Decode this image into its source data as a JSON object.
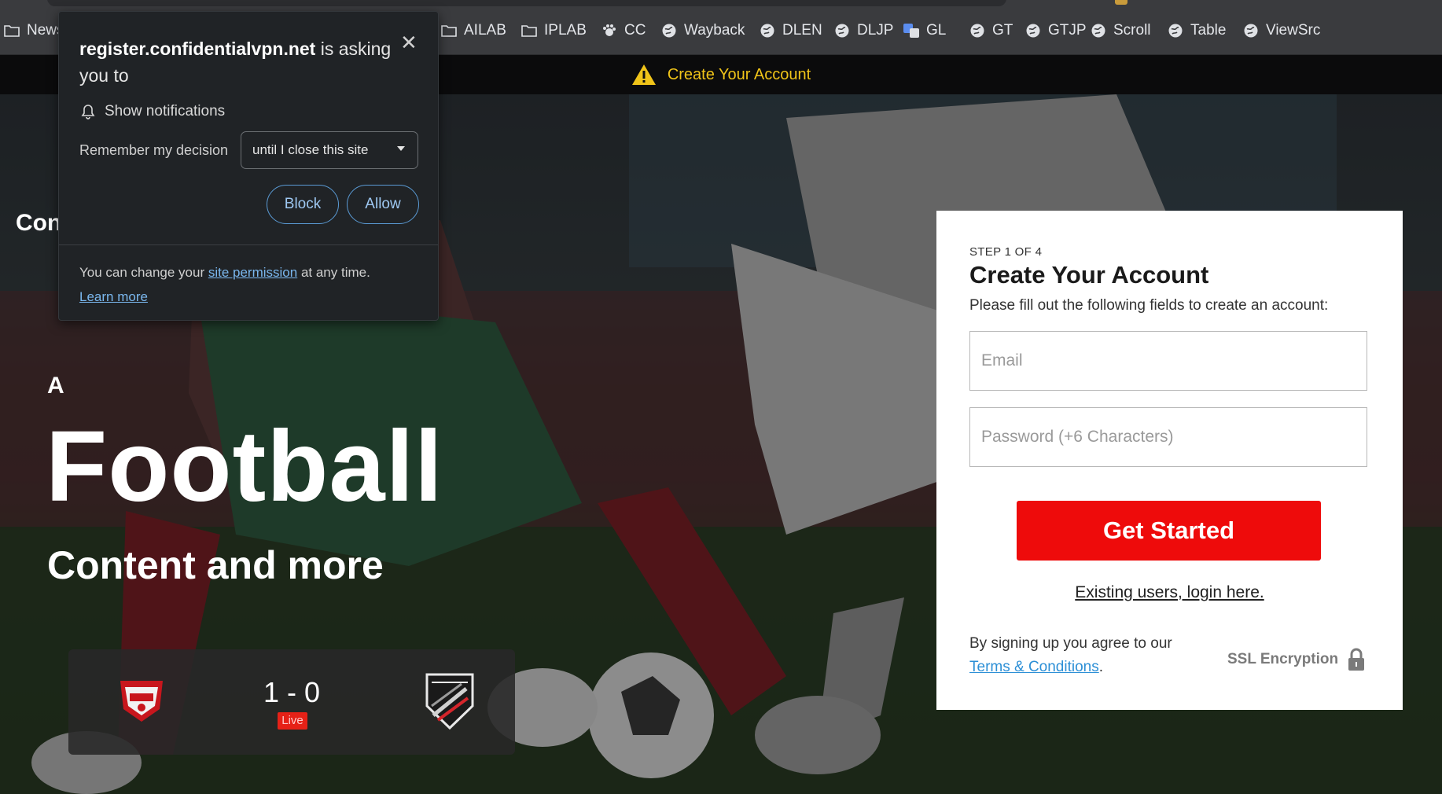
{
  "bookmarks": [
    {
      "label": "News",
      "icon": "folder-icon"
    },
    {
      "label": "AILAB",
      "icon": "folder-icon"
    },
    {
      "label": "IPLAB",
      "icon": "folder-icon"
    },
    {
      "label": "CC",
      "icon": "paw-icon"
    },
    {
      "label": "Wayback",
      "icon": "globe-icon"
    },
    {
      "label": "DLEN",
      "icon": "globe-icon"
    },
    {
      "label": "DLJP",
      "icon": "globe-icon"
    },
    {
      "label": "GL",
      "icon": "translate-icon"
    },
    {
      "label": "GT",
      "icon": "globe-icon"
    },
    {
      "label": "GTJP",
      "icon": "globe-icon"
    },
    {
      "label": "Scroll",
      "icon": "globe-icon"
    },
    {
      "label": "Table",
      "icon": "globe-icon"
    },
    {
      "label": "ViewSrc",
      "icon": "globe-icon"
    }
  ],
  "topbar": {
    "text": "Create Your Account",
    "icon": "warning-icon",
    "color": "#f0c419"
  },
  "hero": {
    "brand": "Con",
    "letter": "A",
    "title": "Football",
    "subtitle": "Content and more",
    "score": {
      "result": "1 - 0",
      "status": "Live",
      "home_logo": "home-team-crest-icon",
      "away_logo": "away-team-crest-icon"
    }
  },
  "signup": {
    "step": "STEP 1 OF 4",
    "title": "Create Your Account",
    "description": "Please fill out the following fields to create an account:",
    "email_placeholder": "Email",
    "password_placeholder": "Password (+6 Characters)",
    "submit_label": "Get Started",
    "login_link": "Existing users, login here.",
    "agree_prefix": "By signing up you agree to our",
    "terms_link": "Terms & Conditions",
    "agree_suffix": ".",
    "ssl_label": "SSL Encryption",
    "accent_color": "#ee0b0b"
  },
  "permission_popup": {
    "site": "register.confidentialvpn.net",
    "asking": "is asking you to",
    "permission": "Show notifications",
    "remember_label": "Remember my decision",
    "remember_value": "until I close this site",
    "block_label": "Block",
    "allow_label": "Allow",
    "footer_prefix": "You can change your",
    "footer_link": "site permission",
    "footer_suffix": "at any time.",
    "learn_more": "Learn more"
  }
}
